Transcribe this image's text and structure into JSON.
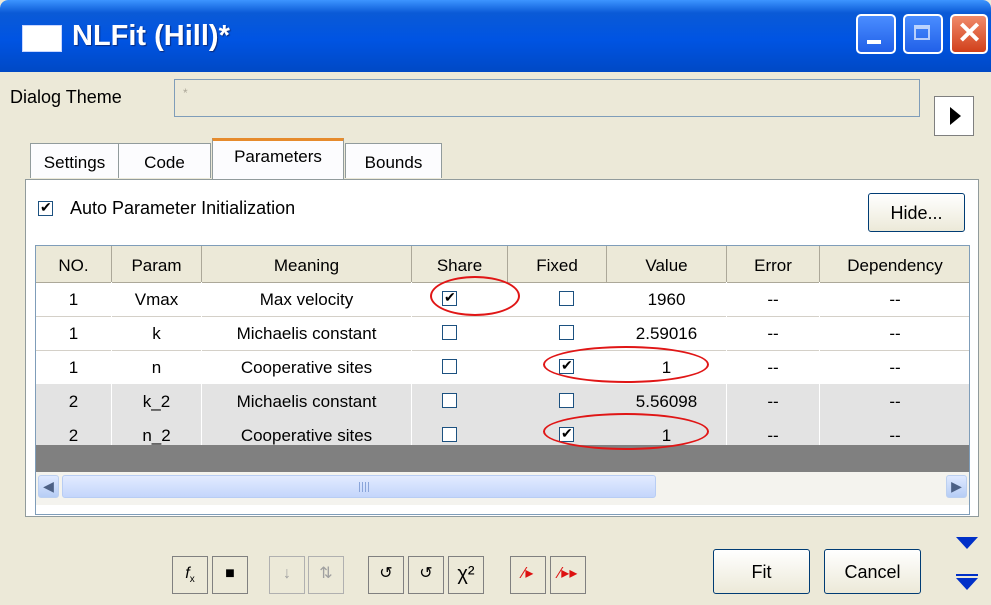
{
  "window": {
    "title": "NLFit (Hill)*"
  },
  "dialog_theme": {
    "label": "Dialog Theme",
    "value": "*"
  },
  "tabs": [
    {
      "label": "Settings"
    },
    {
      "label": "Code"
    },
    {
      "label": "Parameters"
    },
    {
      "label": "Bounds"
    }
  ],
  "auto_init": {
    "label": "Auto Parameter Initialization",
    "checked": true
  },
  "hide_button": "Hide...",
  "table": {
    "columns": [
      "NO.",
      "Param",
      "Meaning",
      "Share",
      "Fixed",
      "Value",
      "Error",
      "Dependency"
    ],
    "rows": [
      {
        "no": "1",
        "param": "Vmax",
        "meaning": "Max velocity",
        "share": true,
        "fixed": false,
        "value": "1960",
        "error": "--",
        "dependency": "--"
      },
      {
        "no": "1",
        "param": "k",
        "meaning": "Michaelis constant",
        "share": false,
        "fixed": false,
        "value": "2.59016",
        "error": "--",
        "dependency": "--"
      },
      {
        "no": "1",
        "param": "n",
        "meaning": "Cooperative sites",
        "share": false,
        "fixed": true,
        "value": "1",
        "error": "--",
        "dependency": "--"
      },
      {
        "no": "2",
        "param": "k_2",
        "meaning": "Michaelis constant",
        "share": false,
        "fixed": false,
        "value": "5.56098",
        "error": "--",
        "dependency": "--"
      },
      {
        "no": "2",
        "param": "n_2",
        "meaning": "Cooperative sites",
        "share": false,
        "fixed": true,
        "value": "1",
        "error": "--",
        "dependency": "--"
      }
    ]
  },
  "toolbar": {
    "icons": [
      "function-icon",
      "save-icon",
      "sort-icon",
      "tree-icon",
      "undo-p-icon",
      "undo-s-icon",
      "chi-square-icon",
      "iterate-icon",
      "iterate-all-icon"
    ],
    "chi_label": "χ²"
  },
  "buttons": {
    "fit": "Fit",
    "cancel": "Cancel"
  }
}
